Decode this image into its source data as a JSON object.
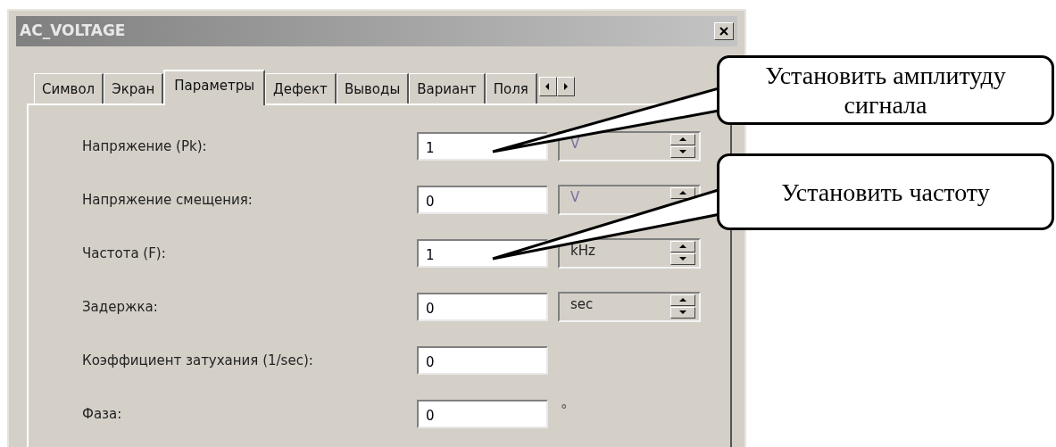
{
  "window": {
    "title": "AC_VOLTAGE"
  },
  "tabs": [
    {
      "label": "Символ",
      "selected": false
    },
    {
      "label": "Экран",
      "selected": false
    },
    {
      "label": "Параметры",
      "selected": true
    },
    {
      "label": "Дефект",
      "selected": false
    },
    {
      "label": "Выводы",
      "selected": false
    },
    {
      "label": "Вариант",
      "selected": false
    },
    {
      "label": "Поля",
      "selected": false
    }
  ],
  "fields": [
    {
      "kind": "spin",
      "label": "Напряжение (Pk):",
      "value": "1",
      "unit": "V",
      "disabled": true
    },
    {
      "kind": "spin",
      "label": "Напряжение смещения:",
      "value": "0",
      "unit": "V",
      "disabled": true
    },
    {
      "kind": "spin",
      "label": "Частота (F):",
      "value": "1",
      "unit": "kHz",
      "disabled": false
    },
    {
      "kind": "spin",
      "label": "Задержка:",
      "value": "0",
      "unit": "sec",
      "disabled": false
    },
    {
      "kind": "plain",
      "label": "Коэффициент затухания (1/sec):",
      "value": "0"
    },
    {
      "kind": "suffix",
      "label": "Фаза:",
      "value": "0",
      "unit": "°"
    }
  ],
  "callouts": [
    {
      "text": "Установить амплитуду сигнала"
    },
    {
      "text": "Установить частоту"
    }
  ]
}
